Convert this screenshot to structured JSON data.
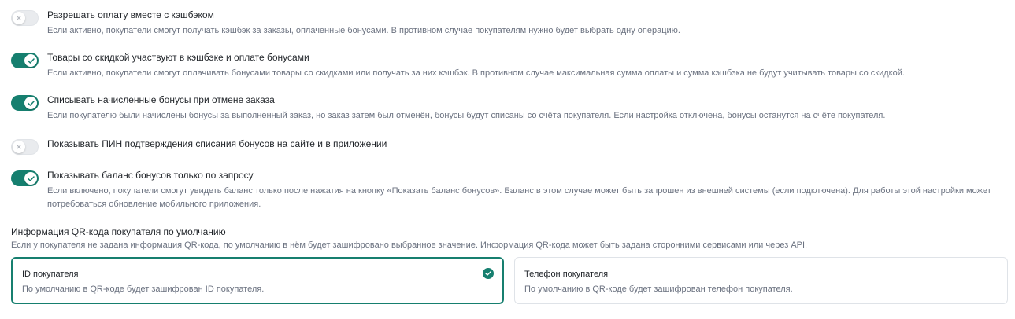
{
  "colors": {
    "accent": "#167f6f",
    "toggle_off": "#e9ebee",
    "text_primary": "#1f2328",
    "text_secondary": "#6b7280",
    "card_border": "#dfe3e8"
  },
  "settings": [
    {
      "title": "Разрешать оплату вместе с кэшбэком",
      "description": "Если активно, покупатели смогут получать кэшбэк за заказы, оплаченные бонусами. В противном случае покупателям нужно будет выбрать одну операцию.",
      "enabled": false,
      "icon": "x-icon"
    },
    {
      "title": "Товары со скидкой участвуют в кэшбэке и оплате бонусами",
      "description": "Если активно, покупатели смогут оплачивать бонусами товары со скидками или получать за них кэшбэк. В противном случае максимальная сумма оплаты и сумма кэшбэка не будут учитывать товары со скидкой.",
      "enabled": true,
      "icon": "check-icon"
    },
    {
      "title": "Списывать начисленные бонусы при отмене заказа",
      "description": "Если покупателю были начислены бонусы за выполненный заказ, но заказ затем был отменён, бонусы будут списаны со счёта покупателя. Если настройка отключена, бонусы останутся на счёте покупателя.",
      "enabled": true,
      "icon": "check-icon"
    },
    {
      "title": "Показывать ПИН подтверждения списания бонусов на сайте и в приложении",
      "description": "",
      "enabled": false,
      "icon": "x-icon"
    },
    {
      "title": "Показывать баланс бонусов только по запросу",
      "description": "Если включено, покупатели смогут увидеть баланс только после нажатия на кнопку «Показать баланс бонусов». Баланс в этом случае может быть запрошен из внешней системы (если подключена). Для работы этой настройки может потребоваться обновление мобильного приложения.",
      "enabled": true,
      "icon": "check-icon"
    }
  ],
  "qr_section": {
    "heading": "Информация QR-кода покупателя по умолчанию",
    "description": "Если у покупателя не задана информация QR-кода, по умолчанию в нём будет зашифровано выбранное значение. Информация QR-кода может быть задана сторонними сервисами или через API.",
    "options": [
      {
        "title": "ID покупателя",
        "description": "По умолчанию в QR-коде будет зашифрован ID покупателя.",
        "selected": true
      },
      {
        "title": "Телефон покупателя",
        "description": "По умолчанию в QR-коде будет зашифрован телефон покупателя.",
        "selected": false
      }
    ]
  }
}
